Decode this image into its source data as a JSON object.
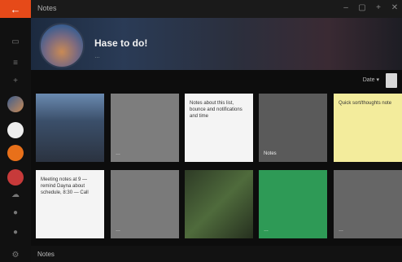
{
  "titlebar": {
    "app_name": "Notes",
    "back_icon": "back-arrow-icon"
  },
  "hero": {
    "title": "Hase to do!",
    "subtitle": "…"
  },
  "toolbar": {
    "sort_label": "Date ▾"
  },
  "tiles": [
    {
      "kind": "photo",
      "text": ""
    },
    {
      "kind": "doc",
      "text": "…"
    },
    {
      "kind": "note",
      "text": "Notes about this list, bounce and notifications and time"
    },
    {
      "kind": "photo",
      "text": "Notes"
    },
    {
      "kind": "sticky",
      "text": "Quick sort/thoughts note"
    },
    {
      "kind": "note",
      "text": "Meeting notes at 9 — remind Dayna about schedule, 8:30 — Call"
    },
    {
      "kind": "doc",
      "text": "…"
    },
    {
      "kind": "photo",
      "text": ""
    },
    {
      "kind": "solid",
      "text": "…"
    },
    {
      "kind": "doc",
      "text": "…"
    }
  ],
  "statusbar": {
    "label": "Notes"
  }
}
